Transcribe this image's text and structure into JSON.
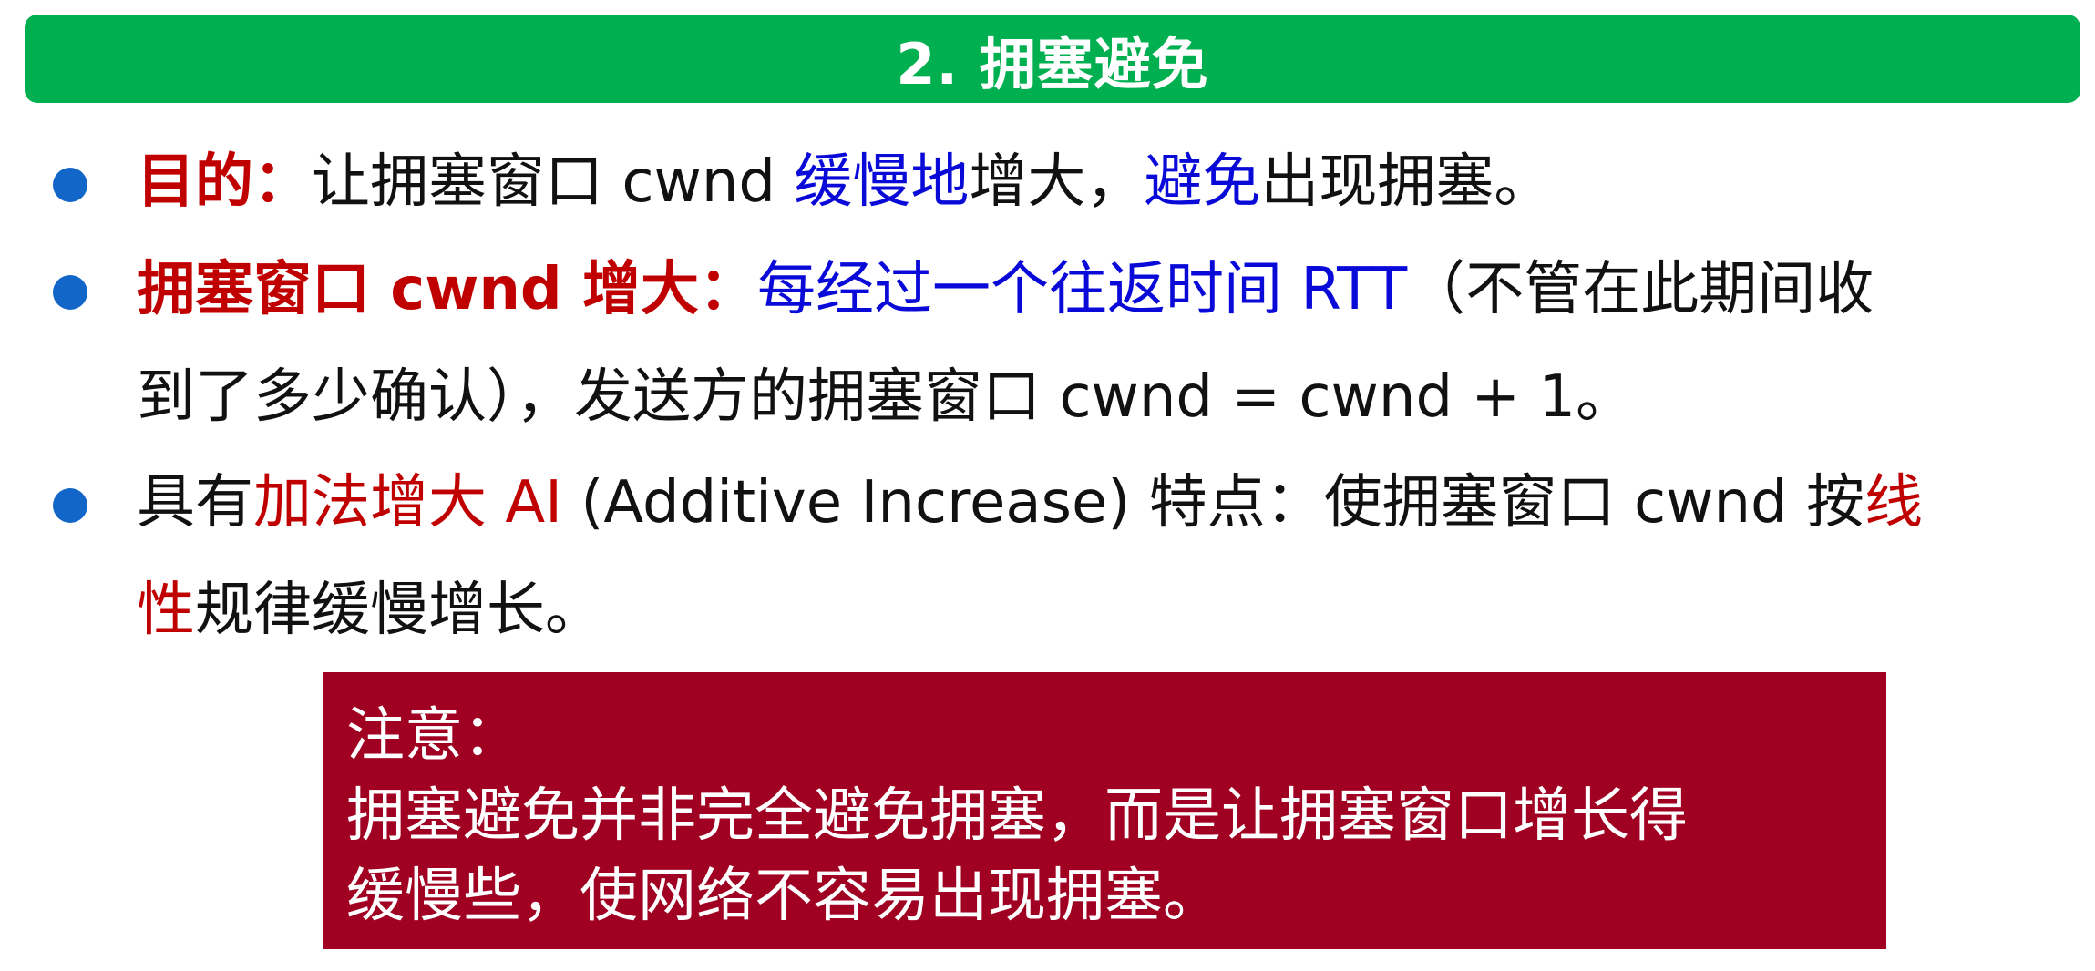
{
  "title": "2. 拥塞避免",
  "bullets": [
    {
      "label": "目的：",
      "text_a": "让拥塞窗口 cwnd ",
      "emph_a": "缓慢地",
      "text_b": "增大，",
      "emph_b": "避免",
      "text_c": "出现拥塞。"
    },
    {
      "label": "拥塞窗口 cwnd 增大：",
      "emph": "每经过一个往返时间 RTT",
      "text_a": "（不管在此期间收",
      "text_b": "到了多少确认），发送方的拥塞窗口 cwnd = cwnd + 1。"
    },
    {
      "text_a": "具有",
      "emph_a": "加法增大 AI",
      "text_b": " (Additive Increase) 特点：使拥塞窗口 cwnd 按",
      "emph_b1": "线",
      "emph_b2": "性",
      "text_c": "规律缓慢增长。"
    }
  ],
  "note": {
    "heading": "注意：",
    "line1": "拥塞避免并非完全避免拥塞，而是让拥塞窗口增长得",
    "line2": "缓慢些，使网络不容易出现拥塞。"
  },
  "colors": {
    "title_bg": "#00b050",
    "accent_red": "#c00000",
    "accent_blue": "#0a0ad8",
    "bullet": "#1166c8",
    "note_bg": "#a00021"
  }
}
